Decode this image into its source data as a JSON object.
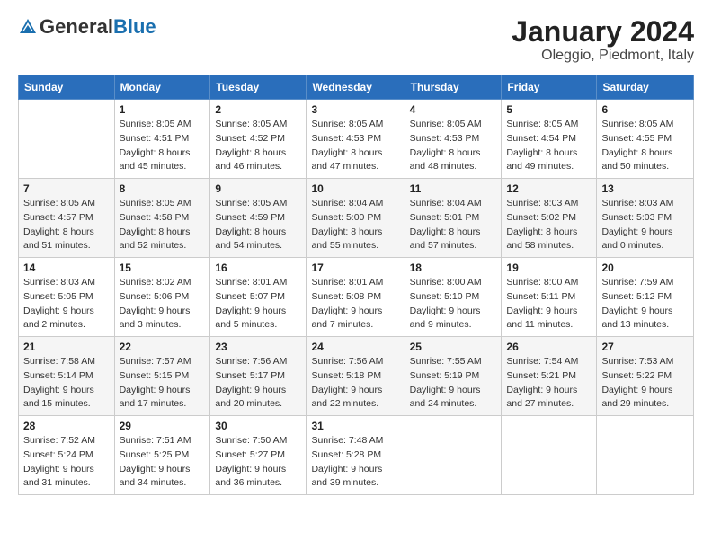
{
  "logo": {
    "general": "General",
    "blue": "Blue"
  },
  "title": "January 2024",
  "subtitle": "Oleggio, Piedmont, Italy",
  "days_header": [
    "Sunday",
    "Monday",
    "Tuesday",
    "Wednesday",
    "Thursday",
    "Friday",
    "Saturday"
  ],
  "weeks": [
    [
      {
        "day": "",
        "sunrise": "",
        "sunset": "",
        "daylight": ""
      },
      {
        "day": "1",
        "sunrise": "Sunrise: 8:05 AM",
        "sunset": "Sunset: 4:51 PM",
        "daylight": "Daylight: 8 hours and 45 minutes."
      },
      {
        "day": "2",
        "sunrise": "Sunrise: 8:05 AM",
        "sunset": "Sunset: 4:52 PM",
        "daylight": "Daylight: 8 hours and 46 minutes."
      },
      {
        "day": "3",
        "sunrise": "Sunrise: 8:05 AM",
        "sunset": "Sunset: 4:53 PM",
        "daylight": "Daylight: 8 hours and 47 minutes."
      },
      {
        "day": "4",
        "sunrise": "Sunrise: 8:05 AM",
        "sunset": "Sunset: 4:53 PM",
        "daylight": "Daylight: 8 hours and 48 minutes."
      },
      {
        "day": "5",
        "sunrise": "Sunrise: 8:05 AM",
        "sunset": "Sunset: 4:54 PM",
        "daylight": "Daylight: 8 hours and 49 minutes."
      },
      {
        "day": "6",
        "sunrise": "Sunrise: 8:05 AM",
        "sunset": "Sunset: 4:55 PM",
        "daylight": "Daylight: 8 hours and 50 minutes."
      }
    ],
    [
      {
        "day": "7",
        "sunrise": "Sunrise: 8:05 AM",
        "sunset": "Sunset: 4:57 PM",
        "daylight": "Daylight: 8 hours and 51 minutes."
      },
      {
        "day": "8",
        "sunrise": "Sunrise: 8:05 AM",
        "sunset": "Sunset: 4:58 PM",
        "daylight": "Daylight: 8 hours and 52 minutes."
      },
      {
        "day": "9",
        "sunrise": "Sunrise: 8:05 AM",
        "sunset": "Sunset: 4:59 PM",
        "daylight": "Daylight: 8 hours and 54 minutes."
      },
      {
        "day": "10",
        "sunrise": "Sunrise: 8:04 AM",
        "sunset": "Sunset: 5:00 PM",
        "daylight": "Daylight: 8 hours and 55 minutes."
      },
      {
        "day": "11",
        "sunrise": "Sunrise: 8:04 AM",
        "sunset": "Sunset: 5:01 PM",
        "daylight": "Daylight: 8 hours and 57 minutes."
      },
      {
        "day": "12",
        "sunrise": "Sunrise: 8:03 AM",
        "sunset": "Sunset: 5:02 PM",
        "daylight": "Daylight: 8 hours and 58 minutes."
      },
      {
        "day": "13",
        "sunrise": "Sunrise: 8:03 AM",
        "sunset": "Sunset: 5:03 PM",
        "daylight": "Daylight: 9 hours and 0 minutes."
      }
    ],
    [
      {
        "day": "14",
        "sunrise": "Sunrise: 8:03 AM",
        "sunset": "Sunset: 5:05 PM",
        "daylight": "Daylight: 9 hours and 2 minutes."
      },
      {
        "day": "15",
        "sunrise": "Sunrise: 8:02 AM",
        "sunset": "Sunset: 5:06 PM",
        "daylight": "Daylight: 9 hours and 3 minutes."
      },
      {
        "day": "16",
        "sunrise": "Sunrise: 8:01 AM",
        "sunset": "Sunset: 5:07 PM",
        "daylight": "Daylight: 9 hours and 5 minutes."
      },
      {
        "day": "17",
        "sunrise": "Sunrise: 8:01 AM",
        "sunset": "Sunset: 5:08 PM",
        "daylight": "Daylight: 9 hours and 7 minutes."
      },
      {
        "day": "18",
        "sunrise": "Sunrise: 8:00 AM",
        "sunset": "Sunset: 5:10 PM",
        "daylight": "Daylight: 9 hours and 9 minutes."
      },
      {
        "day": "19",
        "sunrise": "Sunrise: 8:00 AM",
        "sunset": "Sunset: 5:11 PM",
        "daylight": "Daylight: 9 hours and 11 minutes."
      },
      {
        "day": "20",
        "sunrise": "Sunrise: 7:59 AM",
        "sunset": "Sunset: 5:12 PM",
        "daylight": "Daylight: 9 hours and 13 minutes."
      }
    ],
    [
      {
        "day": "21",
        "sunrise": "Sunrise: 7:58 AM",
        "sunset": "Sunset: 5:14 PM",
        "daylight": "Daylight: 9 hours and 15 minutes."
      },
      {
        "day": "22",
        "sunrise": "Sunrise: 7:57 AM",
        "sunset": "Sunset: 5:15 PM",
        "daylight": "Daylight: 9 hours and 17 minutes."
      },
      {
        "day": "23",
        "sunrise": "Sunrise: 7:56 AM",
        "sunset": "Sunset: 5:17 PM",
        "daylight": "Daylight: 9 hours and 20 minutes."
      },
      {
        "day": "24",
        "sunrise": "Sunrise: 7:56 AM",
        "sunset": "Sunset: 5:18 PM",
        "daylight": "Daylight: 9 hours and 22 minutes."
      },
      {
        "day": "25",
        "sunrise": "Sunrise: 7:55 AM",
        "sunset": "Sunset: 5:19 PM",
        "daylight": "Daylight: 9 hours and 24 minutes."
      },
      {
        "day": "26",
        "sunrise": "Sunrise: 7:54 AM",
        "sunset": "Sunset: 5:21 PM",
        "daylight": "Daylight: 9 hours and 27 minutes."
      },
      {
        "day": "27",
        "sunrise": "Sunrise: 7:53 AM",
        "sunset": "Sunset: 5:22 PM",
        "daylight": "Daylight: 9 hours and 29 minutes."
      }
    ],
    [
      {
        "day": "28",
        "sunrise": "Sunrise: 7:52 AM",
        "sunset": "Sunset: 5:24 PM",
        "daylight": "Daylight: 9 hours and 31 minutes."
      },
      {
        "day": "29",
        "sunrise": "Sunrise: 7:51 AM",
        "sunset": "Sunset: 5:25 PM",
        "daylight": "Daylight: 9 hours and 34 minutes."
      },
      {
        "day": "30",
        "sunrise": "Sunrise: 7:50 AM",
        "sunset": "Sunset: 5:27 PM",
        "daylight": "Daylight: 9 hours and 36 minutes."
      },
      {
        "day": "31",
        "sunrise": "Sunrise: 7:48 AM",
        "sunset": "Sunset: 5:28 PM",
        "daylight": "Daylight: 9 hours and 39 minutes."
      },
      {
        "day": "",
        "sunrise": "",
        "sunset": "",
        "daylight": ""
      },
      {
        "day": "",
        "sunrise": "",
        "sunset": "",
        "daylight": ""
      },
      {
        "day": "",
        "sunrise": "",
        "sunset": "",
        "daylight": ""
      }
    ]
  ]
}
